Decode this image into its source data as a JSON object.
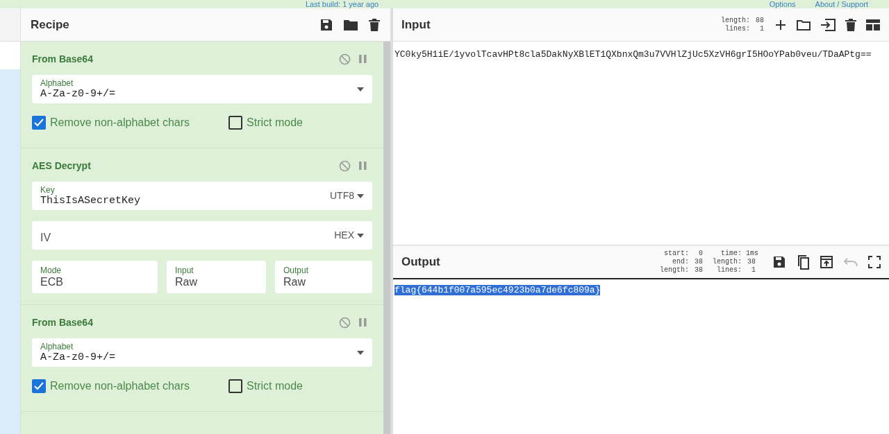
{
  "banner": {
    "build": "Last build: 1 year ago",
    "options": "Options",
    "about": "About / Support"
  },
  "recipe": {
    "title": "Recipe",
    "operations": [
      {
        "name": "From Base64",
        "args": [
          {
            "kind": "dropdown",
            "label": "Alphabet",
            "value": "A-Za-z0-9+/="
          },
          {
            "kind": "checkboxes",
            "items": [
              {
                "label": "Remove non-alphabet chars",
                "checked": true
              },
              {
                "label": "Strict mode",
                "checked": false
              }
            ]
          }
        ]
      },
      {
        "name": "AES Decrypt",
        "args": [
          {
            "kind": "toggle",
            "label": "Key",
            "value": "ThisIsASecretKey",
            "option": "UTF8"
          },
          {
            "kind": "toggle",
            "placeholder": "IV",
            "option": "HEX"
          },
          {
            "kind": "selects",
            "items": [
              {
                "label": "Mode",
                "value": "ECB"
              },
              {
                "label": "Input",
                "value": "Raw"
              },
              {
                "label": "Output",
                "value": "Raw"
              }
            ]
          }
        ]
      },
      {
        "name": "From Base64",
        "args": [
          {
            "kind": "dropdown",
            "label": "Alphabet",
            "value": "A-Za-z0-9+/="
          },
          {
            "kind": "checkboxes",
            "items": [
              {
                "label": "Remove non-alphabet chars",
                "checked": true
              },
              {
                "label": "Strict mode",
                "checked": false
              }
            ]
          }
        ]
      }
    ]
  },
  "input": {
    "title": "Input",
    "stats": [
      [
        "length:",
        "88"
      ],
      [
        "lines:",
        "1"
      ]
    ],
    "text": "YC0ky5H1iE/1yvolTcavHPt8cla5DakNyXBlET1QXbnxQm3u7VVHlZjUc5XzVH6grI5HOoYPab0veu/TDaAPtg=="
  },
  "output": {
    "title": "Output",
    "stats": [
      [
        "start:",
        "0"
      ],
      [
        "end:",
        "38"
      ],
      [
        "length:",
        "38"
      ]
    ],
    "stats2": [
      [
        "time:",
        "1ms"
      ],
      [
        "length:",
        "38"
      ],
      [
        "lines:",
        "1"
      ]
    ],
    "text": "flag{644b1f007a595ec4923b0a7de6fc809a}",
    "selected": true
  }
}
